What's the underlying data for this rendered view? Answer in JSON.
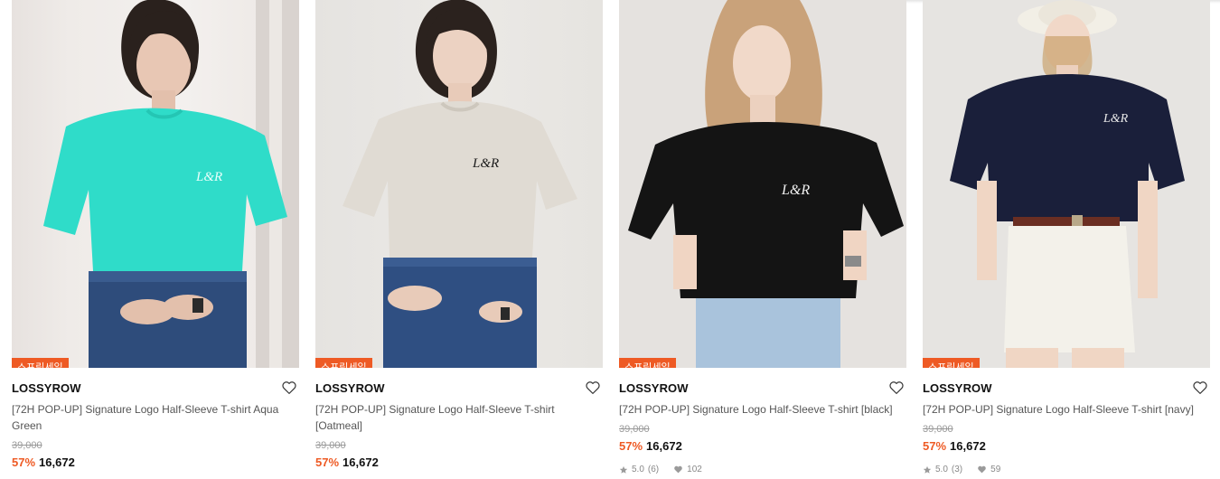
{
  "products": [
    {
      "badge": "스프링세일",
      "brand": "LOSSYROW",
      "title": "[72H POP-UP] Signature Logo Half-Sleeve T-shirt Aqua Green",
      "original_price": "39,000",
      "discount": "57%",
      "price": "16,672",
      "shirt_color": "#2fdcc9",
      "photo_description": "model-aqua-green-tshirt"
    },
    {
      "badge": "스프링세일",
      "brand": "LOSSYROW",
      "title": "[72H POP-UP] Signature Logo Half-Sleeve T-shirt [Oatmeal]",
      "original_price": "39,000",
      "discount": "57%",
      "price": "16,672",
      "shirt_color": "#e0dbd3",
      "photo_description": "model-oatmeal-tshirt"
    },
    {
      "badge": "스프링세일",
      "brand": "LOSSYROW",
      "title": "[72H POP-UP] Signature Logo Half-Sleeve T-shirt [black]",
      "original_price": "39,000",
      "discount": "57%",
      "price": "16,672",
      "rating": "5.0",
      "reviews": "(6)",
      "likes": "102",
      "shirt_color": "#141414",
      "photo_description": "model-black-tshirt"
    },
    {
      "badge": "스프링세일",
      "brand": "LOSSYROW",
      "title": "[72H POP-UP] Signature Logo Half-Sleeve T-shirt [navy]",
      "original_price": "39,000",
      "discount": "57%",
      "price": "16,672",
      "rating": "5.0",
      "reviews": "(3)",
      "likes": "59",
      "shirt_color": "#1a1f3a",
      "photo_description": "model-navy-tshirt"
    }
  ],
  "colors": {
    "accent": "#ee5a24",
    "text": "#111111",
    "muted": "#555555",
    "strike": "#999999"
  },
  "icons": {
    "wishlist": "heart-outline-icon",
    "rating": "star-icon",
    "likes": "heart-filled-icon"
  }
}
